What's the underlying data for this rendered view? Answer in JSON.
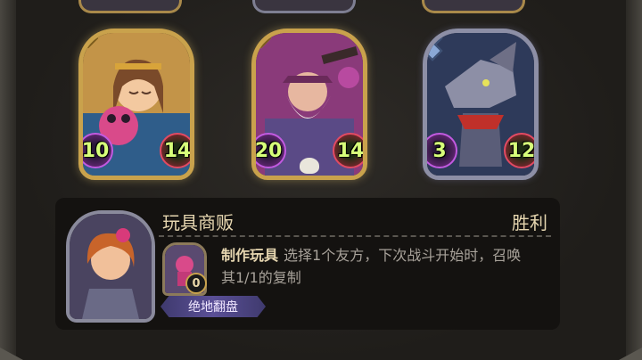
{
  "board": {
    "cards": [
      {
        "id": "doll-girl",
        "attack": "10",
        "health": "14",
        "frame": "gold"
      },
      {
        "id": "old-bandit",
        "attack": "20",
        "health": "14",
        "frame": "gold"
      },
      {
        "id": "rat-scout",
        "attack": "3",
        "health": "12",
        "frame": "silver"
      }
    ]
  },
  "info": {
    "title": "玩具商贩",
    "status": "胜利",
    "mini_card_cost": "0",
    "skill_name": "制作玩具",
    "skill_text": "选择1个友方，下次战斗开始时，召唤其1/1的复制",
    "tag": "绝地翻盘"
  },
  "colors": {
    "gold_frame": "#c9a24c",
    "silver_frame": "#8d8fa6",
    "stat_text": "#d7ff7a",
    "title_text": "#e6d6b0",
    "tag_bg": "#5a4f96"
  }
}
